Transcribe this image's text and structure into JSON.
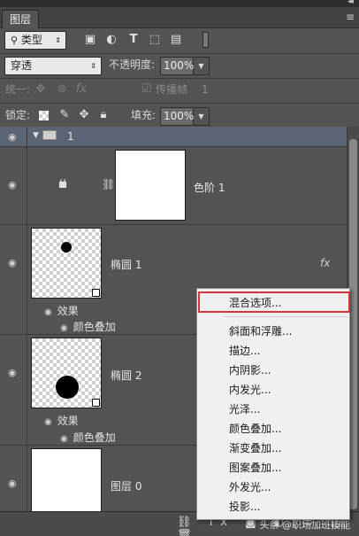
{
  "panel": {
    "tab": "图层",
    "menu_icon": "≡"
  },
  "filter": {
    "kind": "类型",
    "icons": [
      "image-icon",
      "adjust-icon",
      "type-icon",
      "shape-icon",
      "smartobject-icon",
      "toggle-icon"
    ]
  },
  "blend": {
    "mode": "穿透",
    "opacity_label": "不透明度:",
    "opacity": "100%"
  },
  "unify": {
    "label": "统一:",
    "propagate_label": "传播帧",
    "propagate_value": "1"
  },
  "lock": {
    "label": "锁定:",
    "fill_label": "填充:",
    "fill": "100%"
  },
  "layers": [
    {
      "name": "1",
      "type": "group"
    },
    {
      "name": "色阶 1",
      "type": "adjustment"
    },
    {
      "name": "椭圆 1",
      "type": "shape",
      "effects_label": "效果",
      "effect": "颜色叠加"
    },
    {
      "name": "椭圆 2",
      "type": "shape",
      "effects_label": "效果",
      "effect": "颜色叠加"
    },
    {
      "name": "图层 0",
      "type": "pixel"
    }
  ],
  "context_menu": {
    "items": [
      "混合选项...",
      "斜面和浮雕...",
      "描边...",
      "内阴影...",
      "内发光...",
      "光泽...",
      "颜色叠加...",
      "渐变叠加...",
      "图案叠加...",
      "外发光...",
      "投影..."
    ]
  },
  "watermark": {
    "text": "头条 @职场加班技能"
  },
  "colors": {
    "highlight_border": "#d6363b",
    "panel_bg": "#535353",
    "group_row": "#5b6472"
  }
}
